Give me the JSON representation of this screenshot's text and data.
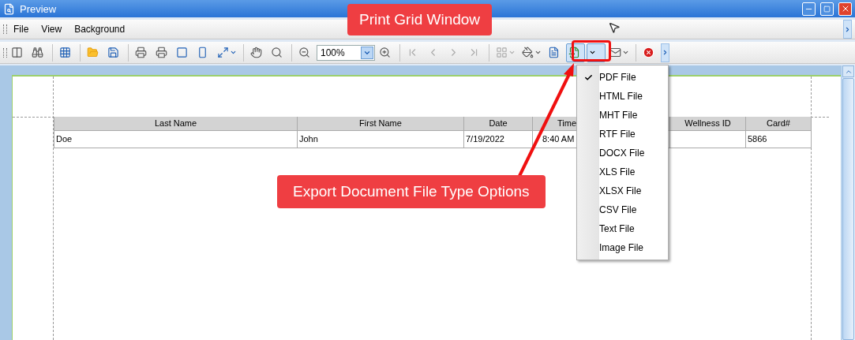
{
  "window": {
    "title": "Preview"
  },
  "menu_bar": [
    "File",
    "View",
    "Background"
  ],
  "toolbar": {
    "zoom": "100%",
    "export_pressed": true
  },
  "table": {
    "columns": [
      "Last Name",
      "First Name",
      "Date",
      "Time",
      "Wellness ID",
      "Card#"
    ],
    "rows": [
      [
        "Doe",
        "John",
        "7/19/2022",
        "8:40 AM",
        null,
        "5866"
      ]
    ]
  },
  "export_menu": [
    {
      "label": "PDF File",
      "checked": true
    },
    {
      "label": "HTML File",
      "checked": false
    },
    {
      "label": "MHT File",
      "checked": false
    },
    {
      "label": "RTF File",
      "checked": false
    },
    {
      "label": "DOCX File",
      "checked": false
    },
    {
      "label": "XLS File",
      "checked": false
    },
    {
      "label": "XLSX File",
      "checked": false
    },
    {
      "label": "CSV File",
      "checked": false
    },
    {
      "label": "Text File",
      "checked": false
    },
    {
      "label": "Image File",
      "checked": false
    }
  ],
  "callouts": [
    {
      "text": "Print Grid Window"
    },
    {
      "text": "Export Document File Type Options"
    }
  ]
}
